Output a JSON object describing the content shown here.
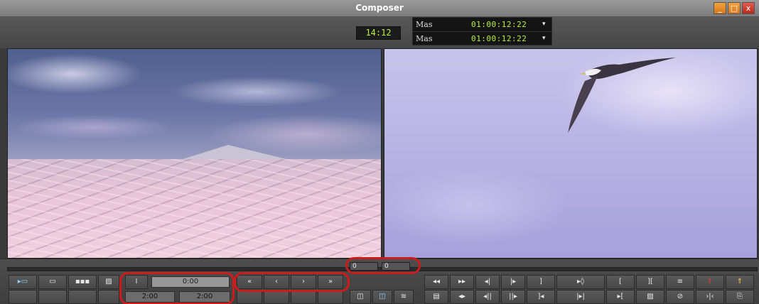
{
  "window": {
    "title": "Composer",
    "controls": [
      "_",
      "□",
      "x"
    ]
  },
  "header": {
    "duration": "14:12",
    "tracks": [
      {
        "label": "Mas",
        "timecode": "01:00:12:22",
        "arrow": "▾"
      },
      {
        "label": "Mas",
        "timecode": "01:00:12:22",
        "arrow": "▾"
      }
    ]
  },
  "center_fields": [
    "0",
    "0"
  ],
  "source_controls": {
    "row1_icons": [
      "▸▭",
      "▭",
      "▪▪▪",
      "▨",
      "I"
    ],
    "position_value": "0:00",
    "mark_in": "2:00",
    "mark_out": "2:00",
    "transport": [
      "«",
      "‹",
      "›",
      "»"
    ]
  },
  "record_controls": {
    "row1": [
      "◂◂",
      "▸▸",
      "◂|",
      "|▸",
      "]",
      "▸◊",
      "[",
      "][",
      "≡",
      "⇑",
      "⇑"
    ],
    "row2_left": [
      "◫",
      "◫",
      "≋"
    ],
    "row2": [
      "▤",
      "◂▸",
      "◂||",
      "||▸",
      "]◂",
      "|▸|",
      "▸[",
      "▨",
      "⊘",
      "›|‹",
      "⎘"
    ]
  }
}
